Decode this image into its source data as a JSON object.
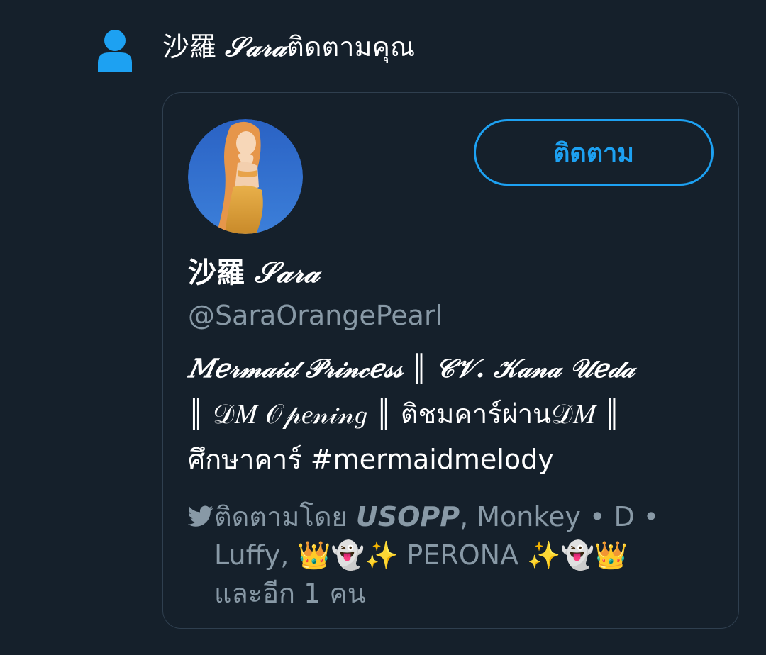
{
  "notification": {
    "icon": "person-icon",
    "name_cjk": "沙羅",
    "name_script": "𝒮𝒶𝓇𝒶",
    "action": "ติดตามคุณ"
  },
  "card": {
    "follow_label": "ติดตาม",
    "display_name_cjk": "沙羅",
    "display_name_script": "𝒮𝒶𝓇𝒶",
    "handle": "@SaraOrangePearl",
    "bio": {
      "line1": "𝑀𝑒𝓇𝓂𝒶𝒾𝒹 𝒫𝓇𝒾𝓃𝒸𝑒𝓈𝓈 ║ 𝒞𝒱. 𝒦𝒶𝓃𝒶 𝒰𝑒𝒹𝒶",
      "line2": "║ 𝒟𝑀 𝒪𝓅𝑒𝓃𝒾𝓃𝑔 ║ ติชมคาร์ผ่าน𝒟𝑀 ║",
      "line3": "ศึกษาคาร์ #mermaidmelody"
    },
    "followed_by": {
      "icon": "bird-icon",
      "prefix": "ติดตามโดย ",
      "name1": "USOPP",
      "rest1": ", Monkey • D •",
      "rest2": "Luffy, 👑👻✨ PERONA ✨👻👑",
      "rest3": "และอีก 1 คน"
    }
  },
  "colors": {
    "background": "#15202b",
    "accent": "#1da1f2",
    "muted": "#8899a6",
    "card_border": "#2f3f4f"
  }
}
